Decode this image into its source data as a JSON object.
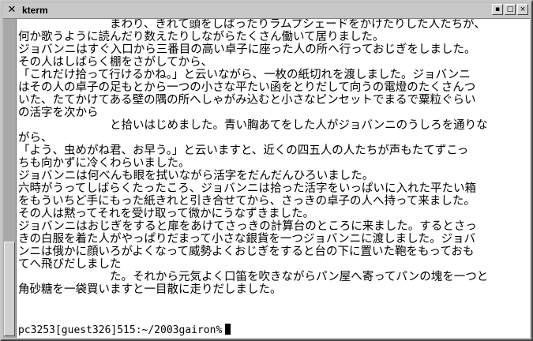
{
  "window": {
    "title": "kterm"
  },
  "titlebar_buttons": {
    "minimize": "▪",
    "maximize": "□",
    "close": "×"
  },
  "terminal_lines": [
    "　　　　　　　　まわり、きれて頭をしばったりラムプシェードをかけたりした人たちが、",
    "何か歌うように読んだり数えたりしながらたくさん働いて居りました。",
    "ジョバンニはすぐ入口から三番目の高い卓子に座った人の所へ行っておじぎをしました。",
    "その人はしばらく棚をさがしてから、",
    "「これだけ拾って行けるかね。」と云いながら、一枚の紙切れを渡しました。ジョバンニ",
    "はその人の卓子の足もとから一つの小さな平たい函をとりだして向うの電燈のたくさんつ",
    "いた、たてかけてある壁の隅の所へしゃがみ込むと小さなピンセットでまるで粟粒ぐらい",
    "の活字を次から",
    "　　　　　　　　と拾いはじめました。青い胸あてをした人がジョバンニのうしろを通りな",
    "がら、",
    "「よう、虫めがね君、お早う。」と云いますと、近くの四五人の人たちが声もたてずこっ",
    "ちも向かずに冷くわらいました。",
    "ジョバンニは何べんも眼を拭いながら活字をだんだんひろいました。",
    "六時がうってしばらくたったころ、ジョバンニは拾った活字をいっぱいに入れた平たい箱",
    "をもういちど手にもった紙きれと引き合せてから、さっきの卓子の人へ持って来ました。",
    "その人は黙ってそれを受け取って微かにうなずきました。",
    "ジョバンニはおじぎをすると扉をあけてさっきの計算台のところに来ました。するとさっ",
    "きの白服を着た人がやっぱりだまって小さな銀貨を一つジョバンニに渡しました。ジョバ",
    "ンニは俄かに顔いろがよくなって威勢よくおじぎをすると台の下に置いた鞄をもっておも",
    "てへ飛びだしました",
    "　　　　　　　　た。それから元気よく口笛を吹きながらパン屋へ寄ってパンの塊を一つと",
    "角砂糖を一袋買いますと一目散に走りだしました。"
  ],
  "prompt": "pc3253[guest326]515:~/2003gairon%"
}
